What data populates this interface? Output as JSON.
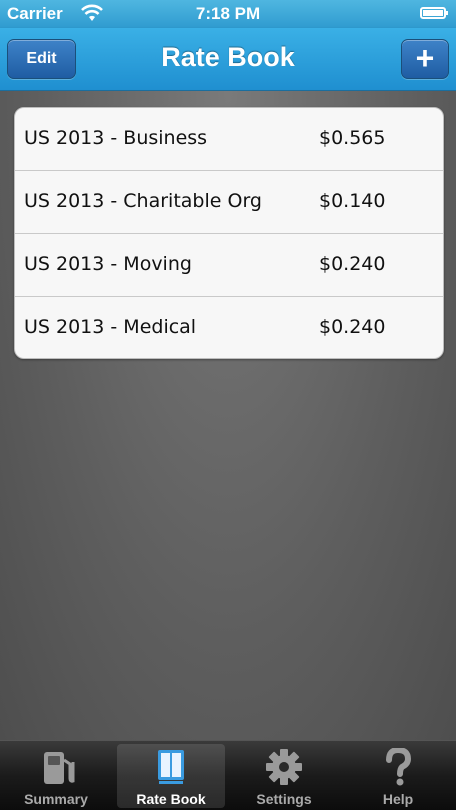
{
  "status_bar": {
    "carrier": "Carrier",
    "time": "7:18 PM"
  },
  "nav": {
    "title": "Rate Book",
    "edit_label": "Edit",
    "add_label": "+"
  },
  "rates": [
    {
      "name": "US 2013 - Business",
      "value": "$0.565"
    },
    {
      "name": "US 2013 - Charitable Org",
      "value": "$0.140"
    },
    {
      "name": "US 2013 - Moving",
      "value": "$0.240"
    },
    {
      "name": "US 2013 - Medical",
      "value": "$0.240"
    }
  ],
  "tabs": [
    {
      "label": "Summary",
      "icon": "fuel-pump-icon"
    },
    {
      "label": "Rate Book",
      "icon": "book-icon",
      "selected": true
    },
    {
      "label": "Settings",
      "icon": "gear-icon"
    },
    {
      "label": "Help",
      "icon": "question-icon"
    }
  ],
  "colors": {
    "nav_blue": "#2f9bd0",
    "button_blue": "#1f5da3",
    "tab_bar": "#1b1b1b"
  }
}
